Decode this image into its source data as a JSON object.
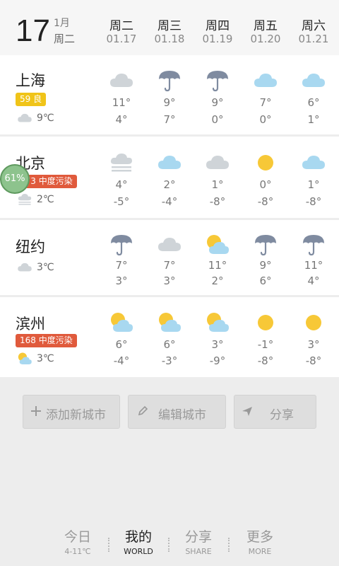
{
  "header": {
    "day": "17",
    "month": "1月",
    "weekday": "周二"
  },
  "dates": [
    {
      "day": "周二",
      "date": "01.17"
    },
    {
      "day": "周三",
      "date": "01.18"
    },
    {
      "day": "周四",
      "date": "01.19"
    },
    {
      "day": "周五",
      "date": "01.20"
    },
    {
      "day": "周六",
      "date": "01.21"
    }
  ],
  "cities": [
    {
      "name": "上海",
      "badge": "59 良",
      "badge_color": "#f0c419",
      "current_temp": "9℃",
      "current_icon": "cloud-icon",
      "forecast": [
        {
          "icon": "cloud-icon",
          "hi": "11°",
          "lo": "4°"
        },
        {
          "icon": "umbrella-icon",
          "hi": "9°",
          "lo": "7°"
        },
        {
          "icon": "umbrella-icon",
          "hi": "9°",
          "lo": "0°"
        },
        {
          "icon": "cloud-blue-icon",
          "hi": "7°",
          "lo": "0°"
        },
        {
          "icon": "cloud-blue-icon",
          "hi": "6°",
          "lo": "1°"
        }
      ]
    },
    {
      "name": "北京",
      "badge": "173 中度污染",
      "badge_color": "#e05a3c",
      "current_temp": "2℃",
      "current_icon": "fog-icon",
      "forecast": [
        {
          "icon": "fog-icon",
          "hi": "4°",
          "lo": "-5°"
        },
        {
          "icon": "cloud-blue-icon",
          "hi": "2°",
          "lo": "-4°"
        },
        {
          "icon": "cloud-icon",
          "hi": "1°",
          "lo": "-8°"
        },
        {
          "icon": "sun-icon",
          "hi": "0°",
          "lo": "-8°"
        },
        {
          "icon": "cloud-blue-icon",
          "hi": "1°",
          "lo": "-8°"
        }
      ]
    },
    {
      "name": "纽约",
      "badge": "",
      "badge_color": "",
      "current_temp": "3℃",
      "current_icon": "cloud-icon",
      "forecast": [
        {
          "icon": "umbrella-icon",
          "hi": "7°",
          "lo": "3°"
        },
        {
          "icon": "cloud-icon",
          "hi": "7°",
          "lo": "3°"
        },
        {
          "icon": "sun-cloud-icon",
          "hi": "11°",
          "lo": "2°"
        },
        {
          "icon": "umbrella-icon",
          "hi": "9°",
          "lo": "6°"
        },
        {
          "icon": "umbrella-icon",
          "hi": "11°",
          "lo": "4°"
        }
      ]
    },
    {
      "name": "滨州",
      "badge": "168 中度污染",
      "badge_color": "#e05a3c",
      "current_temp": "3℃",
      "current_icon": "sun-cloud-icon",
      "forecast": [
        {
          "icon": "sun-cloud-icon",
          "hi": "6°",
          "lo": "-4°"
        },
        {
          "icon": "sun-cloud-icon",
          "hi": "6°",
          "lo": "-3°"
        },
        {
          "icon": "sun-cloud-icon",
          "hi": "3°",
          "lo": "-9°"
        },
        {
          "icon": "sun-icon",
          "hi": "-1°",
          "lo": "-8°"
        },
        {
          "icon": "sun-icon",
          "hi": "3°",
          "lo": "-8°"
        }
      ]
    }
  ],
  "overlay": {
    "aqi_percent": "61%"
  },
  "buttons": {
    "add": "添加新城市",
    "edit": "编辑城市",
    "share": "分享"
  },
  "nav": [
    {
      "label": "今日",
      "sub": "4-11℃"
    },
    {
      "label": "我的",
      "sub": "WORLD"
    },
    {
      "label": "分享",
      "sub": "SHARE"
    },
    {
      "label": "更多",
      "sub": "MORE"
    }
  ],
  "colors": {
    "good": "#f0c419",
    "polluted": "#e05a3c",
    "cloud": "#cfd4d8",
    "cloud_blue": "#a8d8f0",
    "sun": "#f7c837",
    "umbrella": "#7f8ba0"
  }
}
